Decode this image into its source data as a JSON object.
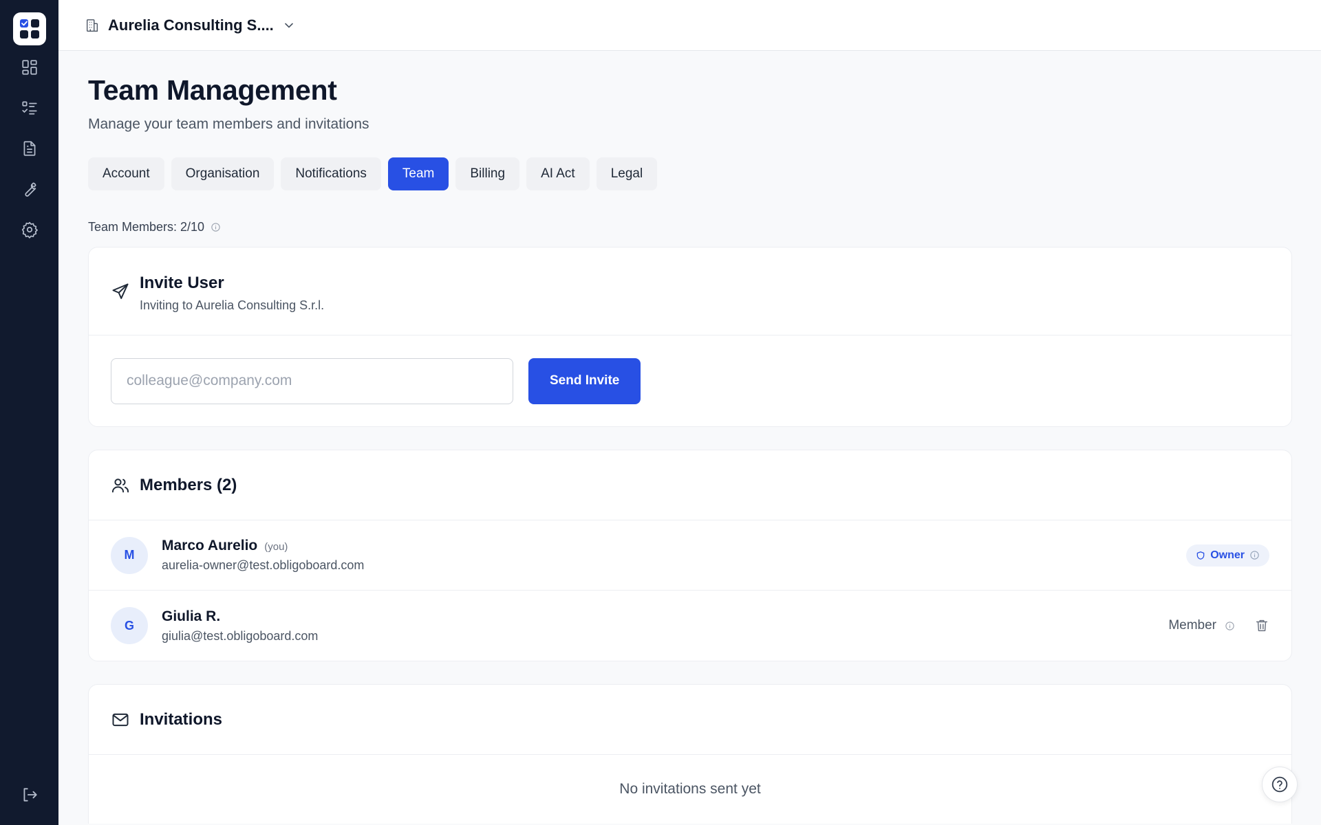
{
  "sidebar": {
    "logo_icon": "app-grid-logo-icon",
    "items": [
      {
        "name": "dashboard",
        "icon": "grid-icon"
      },
      {
        "name": "tasks",
        "icon": "checklist-icon"
      },
      {
        "name": "documents",
        "icon": "document-icon"
      },
      {
        "name": "tools",
        "icon": "wrench-icon"
      },
      {
        "name": "settings",
        "icon": "gear-icon"
      }
    ],
    "logout_icon": "logout-icon"
  },
  "topbar": {
    "org_name": "Aurelia Consulting S....",
    "org_icon": "building-icon",
    "dropdown_icon": "chevron-down-icon"
  },
  "page": {
    "title": "Team Management",
    "subtitle": "Manage your team members and invitations"
  },
  "tabs": [
    {
      "label": "Account",
      "active": false
    },
    {
      "label": "Organisation",
      "active": false
    },
    {
      "label": "Notifications",
      "active": false
    },
    {
      "label": "Team",
      "active": true
    },
    {
      "label": "Billing",
      "active": false
    },
    {
      "label": "AI Act",
      "active": false
    },
    {
      "label": "Legal",
      "active": false
    }
  ],
  "team_members_count": "Team Members: 2/10",
  "invite": {
    "title": "Invite User",
    "subtitle": "Inviting to Aurelia Consulting S.r.l.",
    "email_value": "",
    "email_placeholder": "colleague@company.com",
    "send_label": "Send Invite"
  },
  "members": {
    "title": "Members (2)",
    "list": [
      {
        "initial": "M",
        "name": "Marco Aurelio",
        "you_label": "(you)",
        "email": "aurelia-owner@test.obligoboard.com",
        "role": "Owner"
      },
      {
        "initial": "G",
        "name": "Giulia R.",
        "you_label": "",
        "email": "giulia@test.obligoboard.com",
        "role": "Member"
      }
    ]
  },
  "invitations": {
    "title": "Invitations",
    "empty_text": "No invitations sent yet"
  },
  "colors": {
    "accent": "#2850e4",
    "sidebar_bg": "#111a2e",
    "page_bg": "#f8f9fb"
  }
}
